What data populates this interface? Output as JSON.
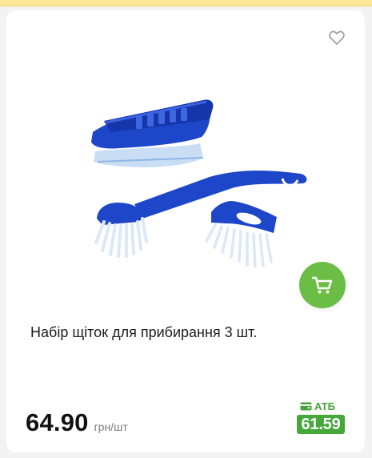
{
  "product": {
    "title": "Набір щіток для прибирання 3 шт.",
    "price": "64.90",
    "unit": "грн/шт",
    "atb_label": "АТБ",
    "atb_price": "61.59"
  },
  "icons": {
    "favorite": "heart-outline-icon",
    "cart": "shopping-cart-icon",
    "atb": "card-icon"
  },
  "colors": {
    "accent_green": "#6bbd45",
    "atb_green": "#46a83c",
    "brush_blue": "#1d46c9",
    "page_bg": "#f3f3f3",
    "top_strip": "#fbe89a"
  }
}
